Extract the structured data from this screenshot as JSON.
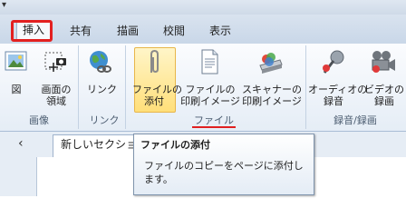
{
  "title_bar": {
    "qat_arrow": "▾"
  },
  "tabs": [
    {
      "label": "挿入",
      "active": true,
      "highlighted": true
    },
    {
      "label": "共有"
    },
    {
      "label": "描画"
    },
    {
      "label": "校閲"
    },
    {
      "label": "表示"
    }
  ],
  "ribbon": {
    "images_group": {
      "label": "画像",
      "buttons": [
        {
          "label": "図",
          "icon": "picture-icon"
        },
        {
          "label": "画面の\n領域",
          "icon": "screen-clipping-icon"
        }
      ]
    },
    "links_group": {
      "label": "リンク",
      "buttons": [
        {
          "label": "リンク",
          "icon": "link-globe-icon"
        }
      ]
    },
    "files_group": {
      "label": "ファイル",
      "buttons": [
        {
          "label": "ファイルの\n添付",
          "icon": "paperclip-icon",
          "selected": true
        },
        {
          "label": "ファイルの\n印刷イメージ",
          "icon": "file-printout-icon"
        },
        {
          "label": "スキャナーの\n印刷イメージ",
          "icon": "scanner-printout-icon"
        }
      ]
    },
    "recording_group": {
      "label": "録音/録画",
      "buttons": [
        {
          "label": "オーディオの\n録音",
          "icon": "microphone-icon"
        },
        {
          "label": "ビデオの\n録画",
          "icon": "video-camera-icon"
        }
      ]
    }
  },
  "page_tab": {
    "label": "新しいセクショ",
    "collapse": "‹"
  },
  "tooltip": {
    "title": "ファイルの添付",
    "description": "ファイルのコピーをページに添付します。"
  },
  "colors": {
    "highlight_red": "#e32020",
    "selected_gold": "#ffdf7a",
    "ribbon_blue": "#c9d7e8"
  }
}
